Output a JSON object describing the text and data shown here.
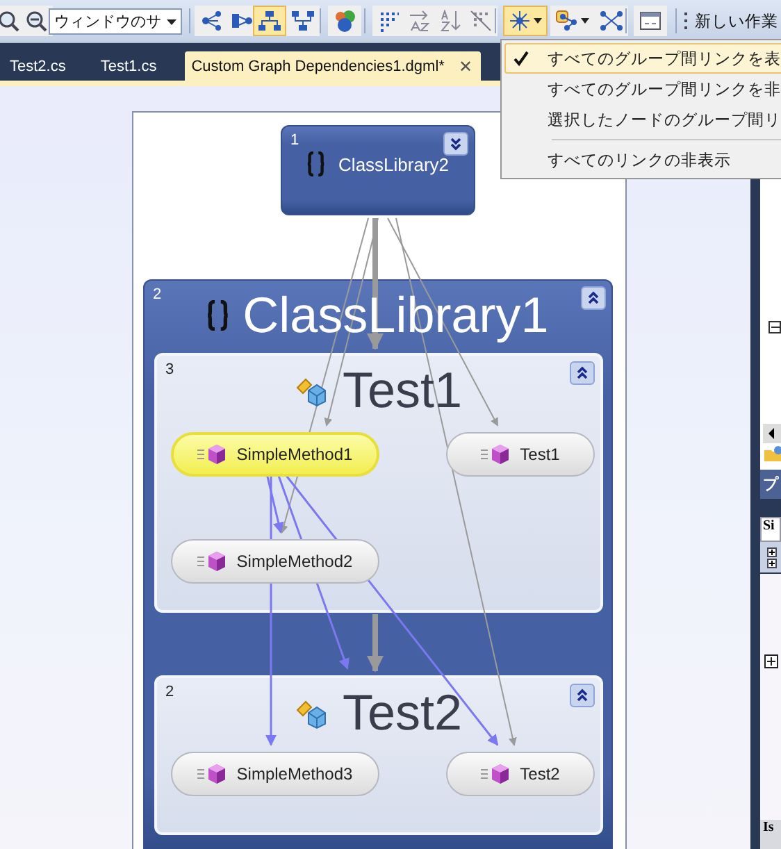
{
  "toolbar": {
    "window_dropdown": {
      "value": "ウィンドウのサ"
    },
    "buttons": [
      {
        "selected": false
      },
      {
        "selected": false
      },
      {
        "selected": false
      },
      {
        "selected": false
      },
      {
        "selected": true
      },
      {
        "selected": false
      },
      {
        "selected": false
      },
      {
        "selected": false
      },
      {
        "selected": false
      },
      {
        "selected": false
      },
      {
        "selected": false
      },
      {
        "selected": true
      },
      {
        "selected": false
      },
      {
        "selected": false
      },
      {
        "selected": false
      }
    ],
    "new_work_item": "新しい作業"
  },
  "tabs": [
    {
      "label": "Test2.cs",
      "selected": false
    },
    {
      "label": "Test1.cs",
      "selected": false
    },
    {
      "label": "Custom Graph Dependencies1.dgml*",
      "selected": true,
      "close": "✕"
    }
  ],
  "link_menu": {
    "items": [
      {
        "kind": "item",
        "label": "すべてのグループ間リンクを表",
        "checked": true
      },
      {
        "kind": "item",
        "label": "すべてのグループ間リンクを非",
        "checked": false
      },
      {
        "kind": "item",
        "label": "選択したノードのグループ間リ",
        "checked": false
      },
      {
        "kind": "separator"
      },
      {
        "kind": "item",
        "label": "すべてのリンクの非表示",
        "checked": false
      }
    ]
  },
  "graph": {
    "groups": [
      {
        "number": "1",
        "title": "ClassLibrary2",
        "expanded": false
      },
      {
        "number": "2",
        "title": "ClassLibrary1",
        "expanded": true,
        "children": [
          {
            "number": "3",
            "title": "Test1",
            "expanded": true,
            "nodes": [
              {
                "label": "SimpleMethod1",
                "selected": true
              },
              {
                "label": "Test1",
                "selected": false
              },
              {
                "label": "SimpleMethod2",
                "selected": false
              }
            ]
          },
          {
            "number": "2",
            "title": "Test2",
            "expanded": true,
            "nodes": [
              {
                "label": "SimpleMethod3",
                "selected": false
              },
              {
                "label": "Test2",
                "selected": false
              }
            ]
          }
        ]
      }
    ]
  },
  "side_panel": {
    "header": "プ",
    "property": "Si",
    "footer": "Is"
  }
}
